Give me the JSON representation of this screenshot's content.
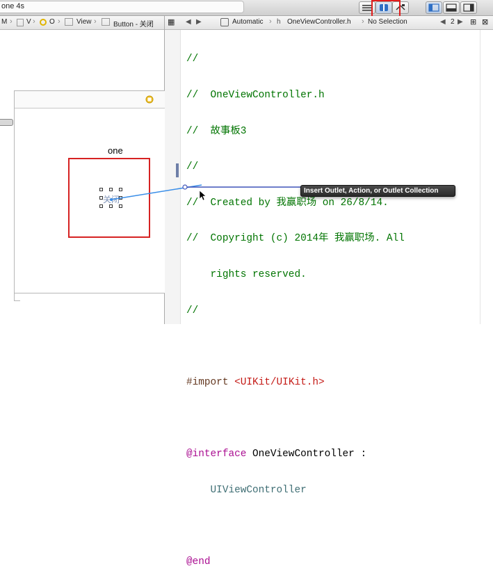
{
  "toolbar": {
    "scheme_text": "one 4s",
    "buttons": [
      "editor-standard",
      "editor-assistant",
      "editor-version",
      "navigator-toggle",
      "debug-toggle",
      "utilities-toggle"
    ]
  },
  "jumpbar_left": {
    "crumbs": [
      "M",
      "V",
      "O",
      "View",
      "Button - 关闭"
    ]
  },
  "jumpbar_right": {
    "mode": "Automatic",
    "file": "OneViewController.h",
    "selection": "No Selection",
    "counter": "2"
  },
  "canvas": {
    "scene_title": "one",
    "button_label": "关闭"
  },
  "code": {
    "lines": [
      "//",
      "//  OneViewController.h",
      "//  故事板3",
      "//",
      "//  Created by 我赢职场 on 26/8/14.",
      "//  Copyright (c) 2014年 我赢职场. All",
      "    rights reserved.",
      "//",
      "",
      "#import <UIKit/UIKit.h>",
      "",
      "@interface OneViewController :",
      "    UIViewController",
      "",
      "@end"
    ]
  },
  "tooltip": {
    "text": "Insert Outlet, Action, or Outlet Collection"
  },
  "colors": {
    "comment": "#007400",
    "keyword": "#aa0d91",
    "string": "#c41a16",
    "highlight": "#e11d1d"
  }
}
